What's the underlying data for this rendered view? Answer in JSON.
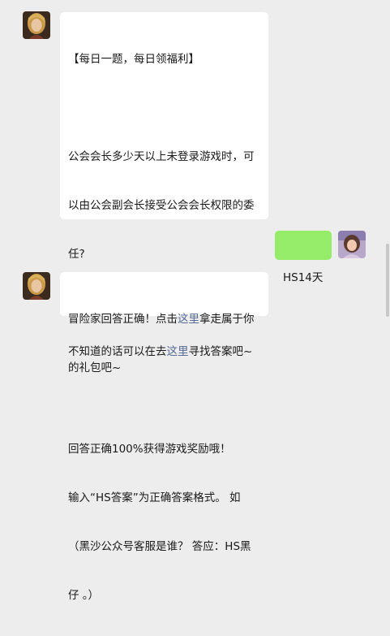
{
  "messages": [
    {
      "sender": "bot",
      "lines": [
        "【每日一题，每日领福利】",
        "",
        "公会会长多少天以上未登录游戏时，可",
        "以由公会副会长接受公会会长权限的委",
        "任?",
        "",
        [
          "不知道的话可以在去",
          "这里",
          "寻找答案吧~"
        ],
        "",
        "回答正确100%获得游戏奖励哦！",
        "输入“HS答案”为正确答案格式。 如",
        "（黑沙公众号客服是谁？ 答应：HS黑",
        "仔 。）"
      ]
    },
    {
      "sender": "user",
      "text": "HS14天"
    },
    {
      "sender": "bot",
      "lines": [
        [
          "冒险家回答正确！点击",
          "这里",
          "拿走属于你"
        ],
        "的礼包吧~"
      ]
    }
  ],
  "colors": {
    "background": "#ededed",
    "bubble_incoming": "#ffffff",
    "bubble_outgoing": "#95ec69",
    "link": "#576b95"
  }
}
